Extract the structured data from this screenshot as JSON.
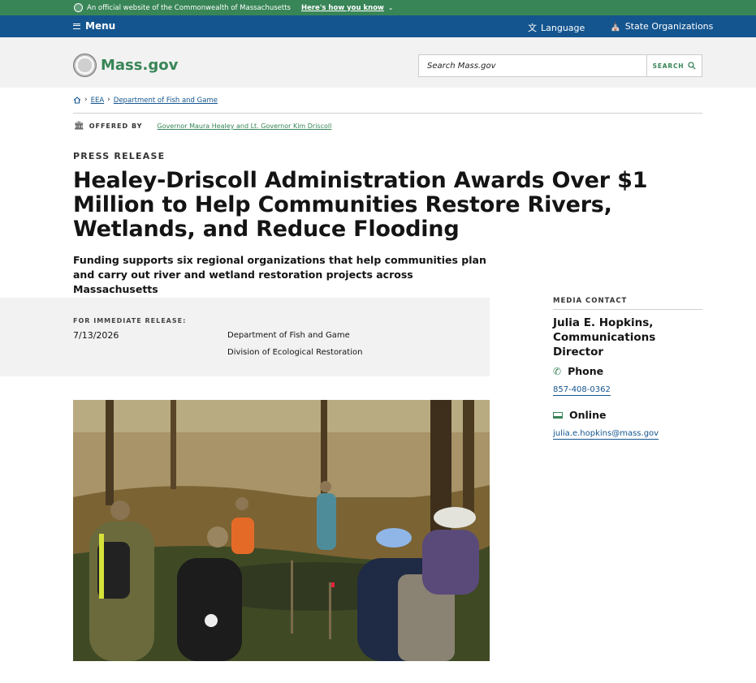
{
  "official_banner": {
    "text": "An official website of the Commonwealth of Massachusetts",
    "link": "Here's how you know"
  },
  "utility": {
    "menu": "Menu",
    "language": "Language",
    "state_orgs": "State Organizations"
  },
  "header": {
    "logo": "Mass.gov",
    "search_placeholder": "Search Mass.gov",
    "search_button": "SEARCH"
  },
  "breadcrumb": [
    "EEA",
    "Department of Fish and Game"
  ],
  "offered": {
    "label": "OFFERED BY",
    "link": "Governor Maura Healey and Lt. Governor Kim Driscoll"
  },
  "article": {
    "kicker": "PRESS RELEASE",
    "title": "Healey-Driscoll Administration Awards Over $1 Million to Help Communities Restore Rivers, Wetlands, and Reduce Flooding",
    "subtitle": "Funding supports six regional organizations that help communities plan and carry out river and wetland restoration projects across Massachusetts"
  },
  "release": {
    "label": "FOR IMMEDIATE RELEASE:",
    "date": "7/13/2026",
    "orgs": [
      "Department of Fish and Game",
      "Division of Ecological Restoration"
    ]
  },
  "contact": {
    "label": "MEDIA CONTACT",
    "name": "Julia E. Hopkins, Communications Director",
    "phone_label": "Phone",
    "phone": "857-408-0362",
    "online_label": "Online",
    "email": "julia.e.hopkins@mass.gov"
  },
  "colors": {
    "green": "#388557",
    "blue": "#14558f",
    "gray_bg": "#f2f2f2"
  }
}
